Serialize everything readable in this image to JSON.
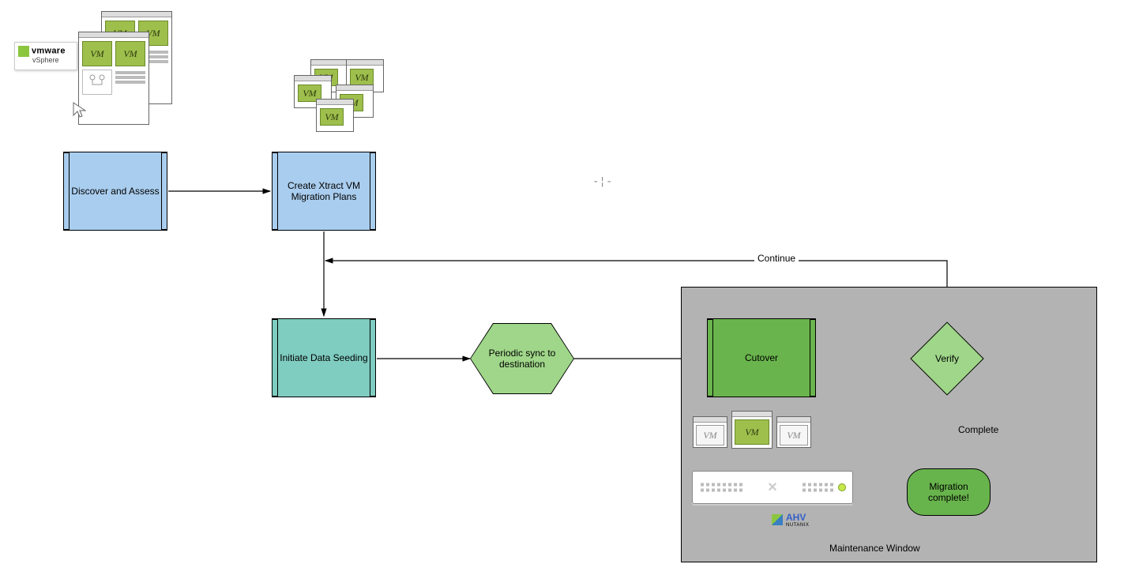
{
  "vendor": {
    "vmware_line1": "vmware",
    "vmware_line2": "vSphere",
    "ahv_small": "NUTANIX",
    "ahv_big": "AHV"
  },
  "nodes": {
    "discover": "Discover and Assess",
    "create_plans": "Create Xtract VM Migration Plans",
    "initiate_seeding": "Initiate Data Seeding",
    "periodic_sync": "Periodic sync to destination",
    "cutover": "Cutover",
    "verify": "Verify",
    "migration_complete": "Migration complete!"
  },
  "edges": {
    "continue": "Continue",
    "complete": "Complete"
  },
  "regions": {
    "maintenance_window": "Maintenance Window"
  },
  "glyphs": {
    "vm": "VM"
  }
}
